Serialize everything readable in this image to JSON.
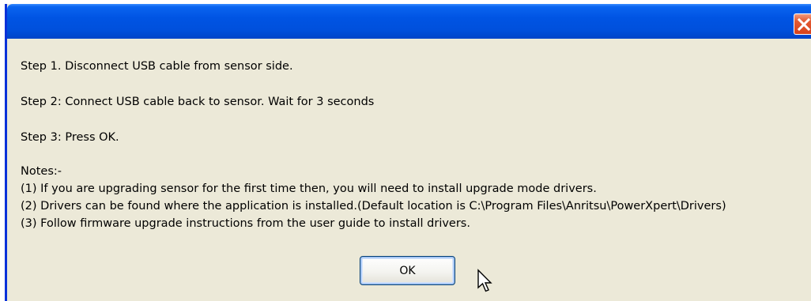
{
  "dialog": {
    "steps": [
      "Step 1. Disconnect USB cable from sensor side.",
      "Step 2: Connect USB cable back to sensor. Wait for 3 seconds",
      "Step 3: Press OK."
    ],
    "notes_heading": "Notes:-",
    "notes": [
      "(1) If you are upgrading sensor for the first time then, you will need to install upgrade mode drivers.",
      "(2) Drivers can be found where the application is installed.(Default location is C:\\Program Files\\Anritsu\\PowerXpert\\Drivers)",
      "(3) Follow firmware upgrade instructions from the user guide to install drivers."
    ],
    "ok_label": "OK"
  },
  "icons": {
    "close": "close-icon",
    "cursor": "mouse-pointer-icon"
  },
  "colors": {
    "titlebar": "#0054e3",
    "window_bg": "#ece9d8",
    "close_button": "#d8431c"
  }
}
